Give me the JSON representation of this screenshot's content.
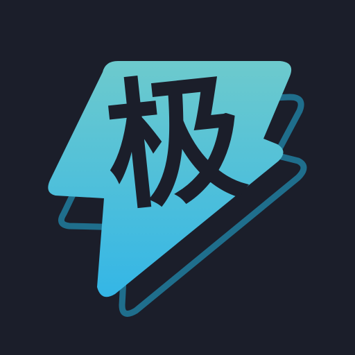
{
  "app_icon": {
    "character": "极",
    "background_color": "#1b1e2a",
    "bolt_gradient_top": "#6dcacd",
    "bolt_gradient_bottom": "#34b6e6",
    "outline_color": "#1f6e8c",
    "glyph_color": "#1b1e2a",
    "shape": "lightning-bolt-icon"
  }
}
